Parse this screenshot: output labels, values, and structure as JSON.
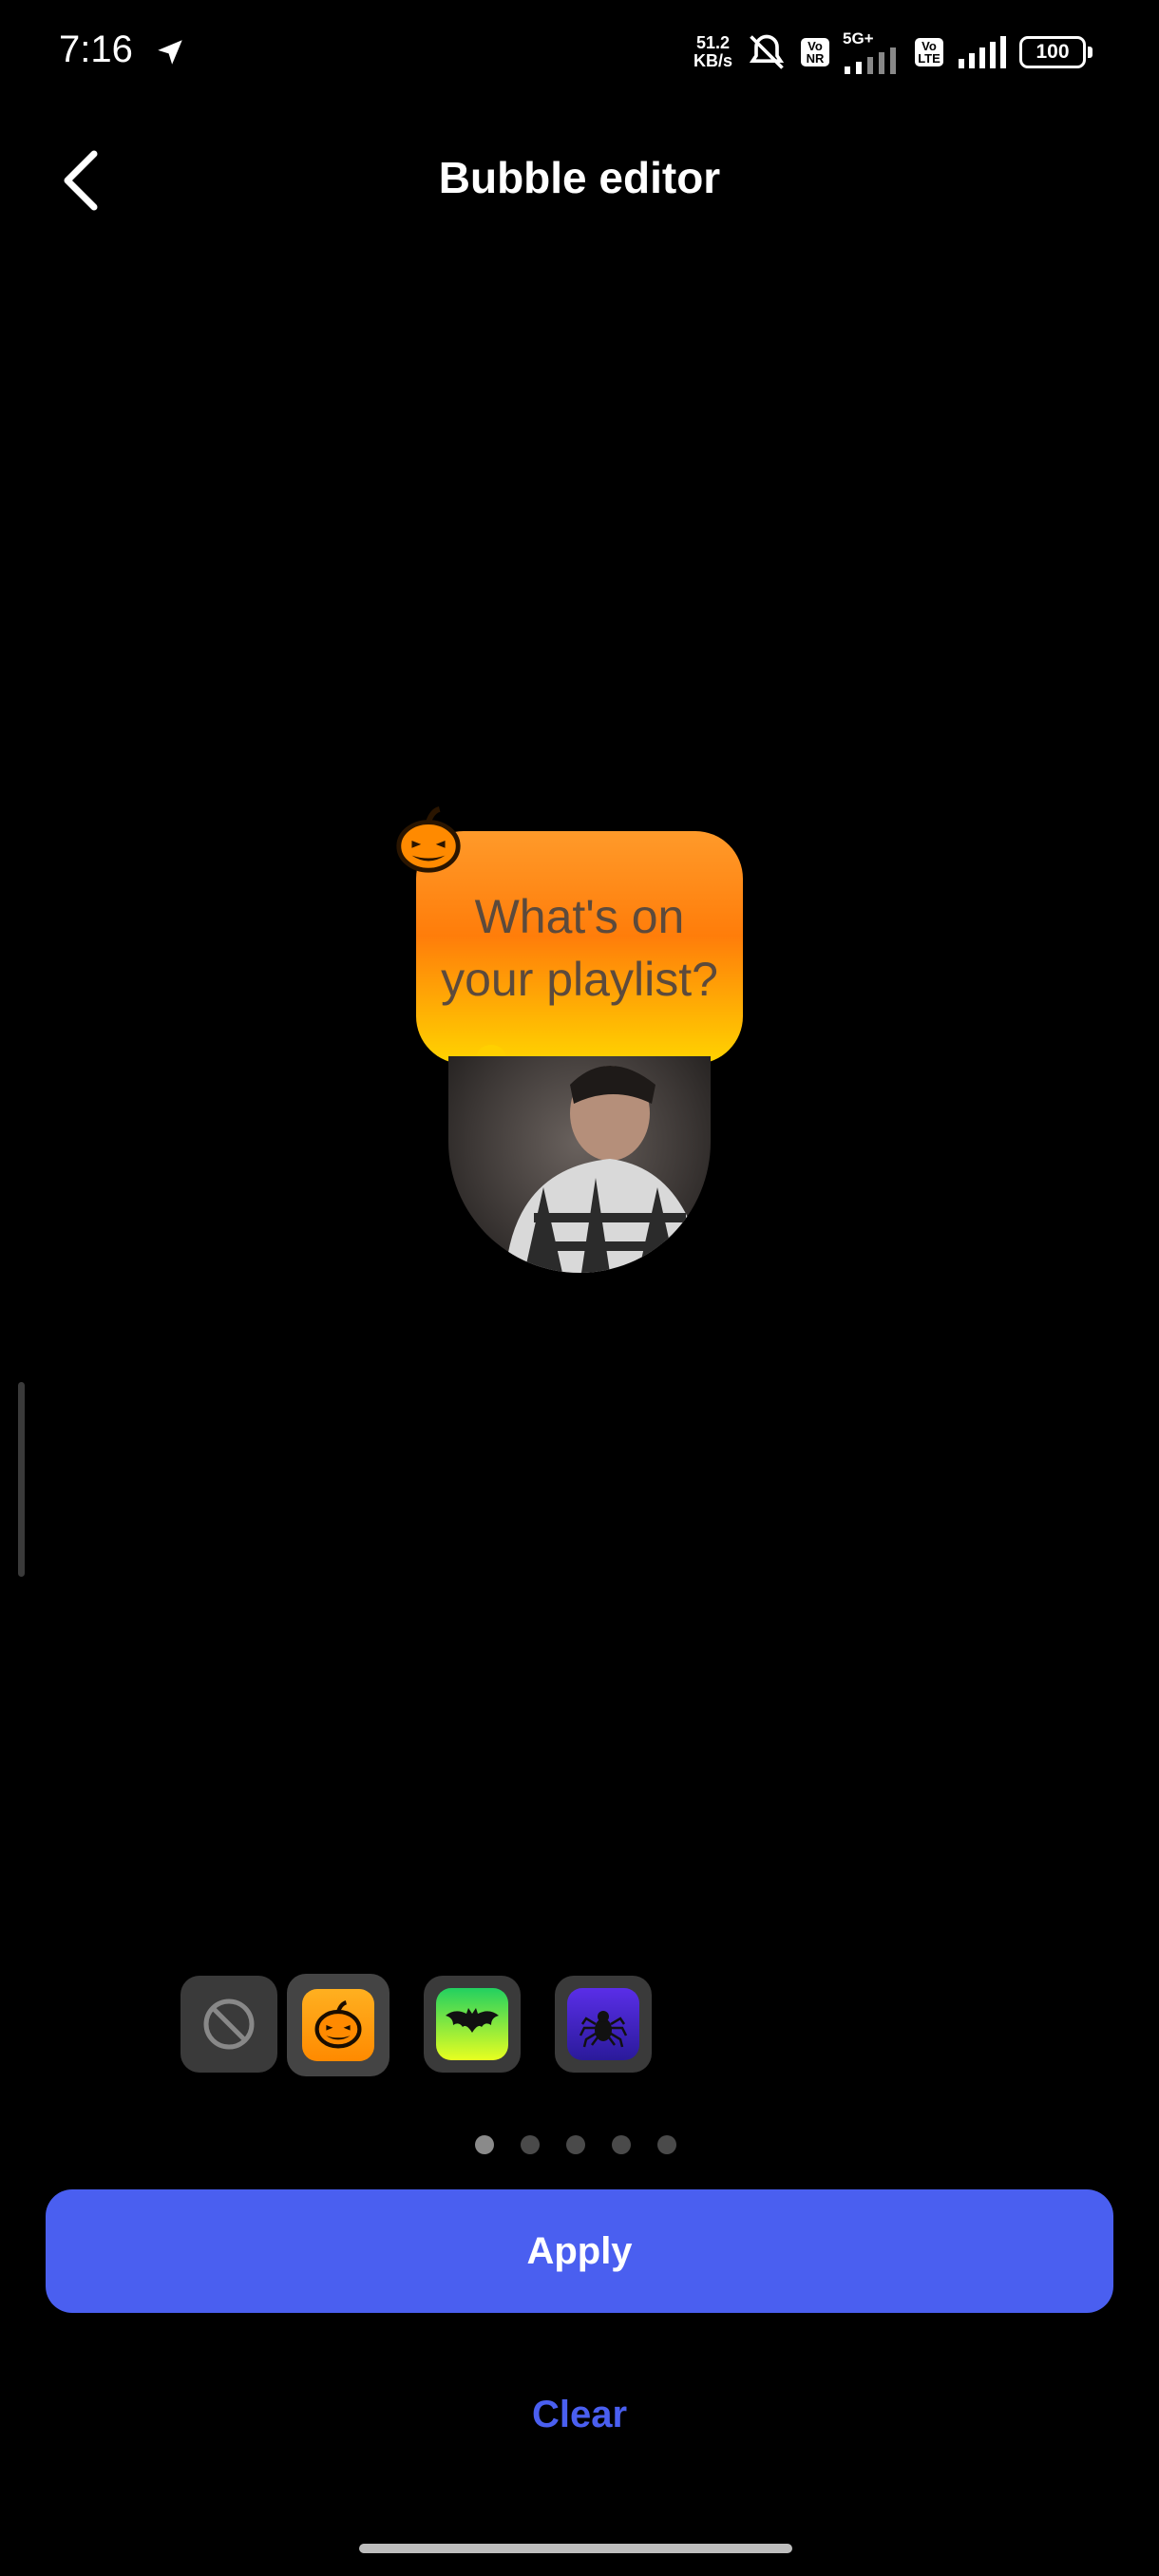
{
  "status_bar": {
    "time": "7:16",
    "net_speed_value": "51.2",
    "net_speed_unit": "KB/s",
    "network_5g": "5G+",
    "volte_badge_1": "Vo NR",
    "volte_badge_2": "Vo LTE",
    "battery": "100"
  },
  "header": {
    "title": "Bubble editor"
  },
  "preview": {
    "bubble_text": "What's on your playlist?"
  },
  "styles": {
    "items": [
      {
        "name": "none",
        "icon": "prohibited-icon",
        "selected": false
      },
      {
        "name": "pumpkin",
        "icon": "pumpkin-icon",
        "selected": true
      },
      {
        "name": "bat",
        "icon": "bat-icon",
        "selected": false
      },
      {
        "name": "spider",
        "icon": "spider-icon",
        "selected": false
      }
    ],
    "pages": 5,
    "current_page": 1
  },
  "actions": {
    "apply_label": "Apply",
    "clear_label": "Clear"
  },
  "colors": {
    "accent": "#4a5ff0",
    "bubble_top": "#ff9a2a",
    "bubble_bottom": "#ffd400",
    "background": "#000000"
  }
}
